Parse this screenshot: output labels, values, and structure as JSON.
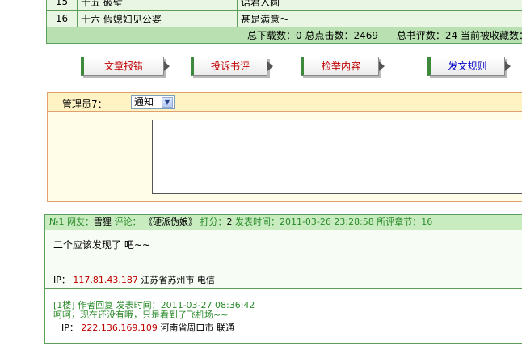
{
  "chapters": [
    {
      "num": "15",
      "title": "十五 破壁",
      "note": "语君入圆"
    },
    {
      "num": "16",
      "title": "十六 假媳妇见公婆",
      "note": "甚是满意～"
    }
  ],
  "stats": {
    "downloads": "总下载数：0",
    "clicks": "总点击数：2469",
    "reviews": "总书评数：24",
    "favorites": "当前被收藏数："
  },
  "buttons": {
    "report_error": "文章报错",
    "complain_review": "投诉书评",
    "report_content": "检举内容",
    "posting_rules": "发文规则"
  },
  "admin": {
    "label": "管理员7：",
    "notice_type": "通知"
  },
  "review": {
    "number": "№1",
    "user_key": "网友：",
    "user": "雪狸",
    "comment_key": "评论：",
    "title": "《硬派伪娘》",
    "score_key": "打分：",
    "score": "2",
    "time_key": "发表时间：",
    "time": "2011-03-26 23:28:58",
    "chapter_key": "所评章节：",
    "chapter": "16",
    "content": "二个应该发现了 吧~~",
    "ip_label": "IP：",
    "ip": "117.81.43.187",
    "location": "江苏省苏州市 电信"
  },
  "reply": {
    "meta": "[1楼] 作者回复  发表时间：2011-03-27 08:36:42",
    "content": "呵呵，现在还没有哦，只是看到了飞机场~~",
    "ip_label": "IP：",
    "ip": "222.136.169.109",
    "location": "河南省周口市 联通"
  }
}
